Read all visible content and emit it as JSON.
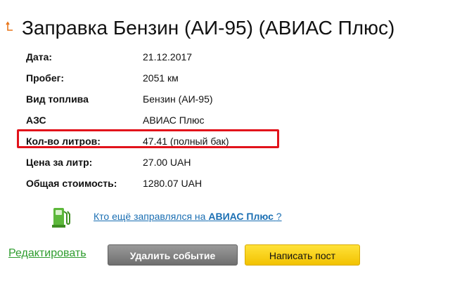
{
  "header": {
    "back_icon": "back-arrow-icon",
    "title": "Заправка Бензин (АИ-95) (АВИАС Плюс)"
  },
  "details": [
    {
      "label": "Дата:",
      "value": "21.12.2017"
    },
    {
      "label": "Пробег:",
      "value": "2051 км"
    },
    {
      "label": "Вид топлива",
      "value": "Бензин (АИ-95)"
    },
    {
      "label": "АЗС",
      "value": "АВИАС Плюс"
    },
    {
      "label": "Кол-во литров:",
      "value": "47.41 (полный бак)"
    },
    {
      "label": "Цена за литр:",
      "value": "27.00 UAH"
    },
    {
      "label": "Общая стоимость:",
      "value": "1280.07 UAH"
    }
  ],
  "highlight_color": "#e2121b",
  "fuel_link": {
    "icon": "fuel-pump-icon",
    "prefix": "Кто ещё заправлялся на",
    "station": "АВИАС Плюс",
    "suffix": "?"
  },
  "actions": {
    "edit_label": "Редактировать",
    "delete_label": "Удалить событие",
    "post_label": "Написать пост"
  },
  "colors": {
    "link": "#1b6fb3",
    "edit_link": "#2e9c2e",
    "delete_button": "#7f7f7f",
    "post_button": "#ffd400"
  }
}
